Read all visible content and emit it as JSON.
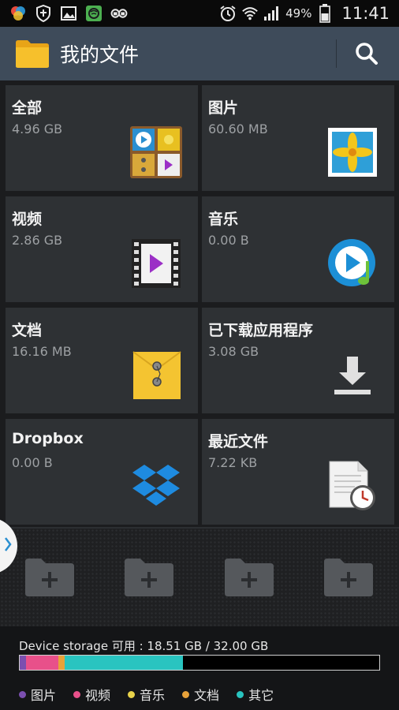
{
  "status_bar": {
    "battery_text": "49%",
    "time": "11:41",
    "left_icons": [
      "photos-app-icon",
      "shield-icon",
      "gallery-icon",
      "wifi-hotspot-icon",
      "reader-icon"
    ],
    "right_icons": [
      "alarm-icon",
      "wifi-icon",
      "signal-icon",
      "battery-icon"
    ]
  },
  "action_bar": {
    "title": "我的文件",
    "folder_icon": "folder-icon",
    "search_icon": "search-icon"
  },
  "categories": [
    {
      "title": "全部",
      "size": "4.96 GB",
      "icon": "all-files-icon"
    },
    {
      "title": "图片",
      "size": "60.60 MB",
      "icon": "image-icon"
    },
    {
      "title": "视频",
      "size": "2.86 GB",
      "icon": "video-icon"
    },
    {
      "title": "音乐",
      "size": "0.00 B",
      "icon": "music-icon"
    },
    {
      "title": "文档",
      "size": "16.16 MB",
      "icon": "document-icon"
    },
    {
      "title": "已下载应用程序",
      "size": "3.08 GB",
      "icon": "download-icon"
    },
    {
      "title": "Dropbox",
      "size": "0.00 B",
      "icon": "dropbox-icon"
    },
    {
      "title": "最近文件",
      "size": "7.22 KB",
      "icon": "recent-files-icon"
    }
  ],
  "shortcuts": {
    "add_folder_count": 4,
    "handle_icon": "chevron-right-icon"
  },
  "storage": {
    "label": "Device storage 可用 : 18.51 GB / 32.00 GB",
    "segments": [
      {
        "name": "图片",
        "fraction": 0.018,
        "color": "#7b4fb0"
      },
      {
        "name": "视频",
        "fraction": 0.089,
        "color": "#e8508a"
      },
      {
        "name": "音乐",
        "fraction": 0.0,
        "color": "#e8d24a"
      },
      {
        "name": "文档",
        "fraction": 0.018,
        "color": "#e8a23a"
      },
      {
        "name": "其它",
        "fraction": 0.33,
        "color": "#29c4c0"
      }
    ],
    "legend": [
      {
        "label": "图片",
        "color": "#7b4fb0"
      },
      {
        "label": "视频",
        "color": "#e8508a"
      },
      {
        "label": "音乐",
        "color": "#e8d24a"
      },
      {
        "label": "文档",
        "color": "#e8a23a"
      },
      {
        "label": "其它",
        "color": "#29c4c0"
      }
    ]
  }
}
